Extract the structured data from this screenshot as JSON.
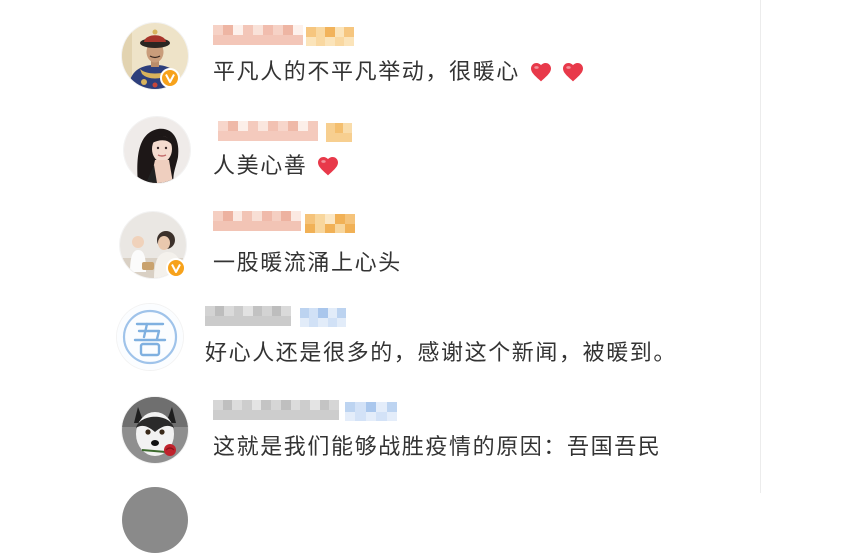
{
  "colors": {
    "text": "#333333",
    "badge": "#f7a21b",
    "heart": "#e8394a",
    "divider": "#ececec"
  },
  "comments": [
    {
      "verified": true,
      "username_mosaic": [
        "#f6d2c6",
        "#f1bdae",
        "#f9e2d9",
        "#f3c6b8",
        "#fdf1ec",
        "#eeb5a3"
      ],
      "tag_mosaic": [
        "#f6c67f",
        "#f9d8a1",
        "#f2b35b",
        "#fbe4ba"
      ],
      "text": "平凡人的不平凡举动，很暖心",
      "hearts": 2
    },
    {
      "verified": false,
      "username_mosaic": [
        "#f7d6cb",
        "#f2c1b2",
        "#fae6de",
        "#f4cabd",
        "#fcefe9",
        "#efb9a8"
      ],
      "tag_mosaic": [
        "#f7cf90",
        "#f9dcaa",
        "#f4bf6f"
      ],
      "text": "人美心善",
      "hearts": 1
    },
    {
      "verified": true,
      "username_mosaic": [
        "#f5cfc2",
        "#f0baaa",
        "#f8dfd5",
        "#f2c4b5",
        "#fbe9e2",
        "#edb2a0"
      ],
      "tag_mosaic": [
        "#f5c37a",
        "#f8d69c",
        "#fbe7c4",
        "#f1b156"
      ],
      "text": "一股暖流涌上心头",
      "hearts": 0
    },
    {
      "verified": false,
      "username_mosaic": [
        "#d3d3d3",
        "#c2c2c2",
        "#e2e2e2",
        "#cbcbcb",
        "#dadada",
        "#bdbdbd"
      ],
      "tag_mosaic": [
        "#bcd3f0",
        "#d1e1f6",
        "#a9c6ec",
        "#e2ecf9"
      ],
      "text": "好心人还是很多的，感谢这个新闻，被暖到。",
      "hearts": 0
    },
    {
      "verified": false,
      "username_mosaic": [
        "#d6d6d6",
        "#c4c4c4",
        "#e4e4e4",
        "#cdcdcd",
        "#dcdcdc",
        "#bfbfbf"
      ],
      "tag_mosaic": [
        "#bdd4f1",
        "#d3e2f7",
        "#aac7ed",
        "#e4edfa"
      ],
      "text": "这就是我们能够战胜疫情的原因：吾国吾民",
      "hearts": 0
    }
  ]
}
